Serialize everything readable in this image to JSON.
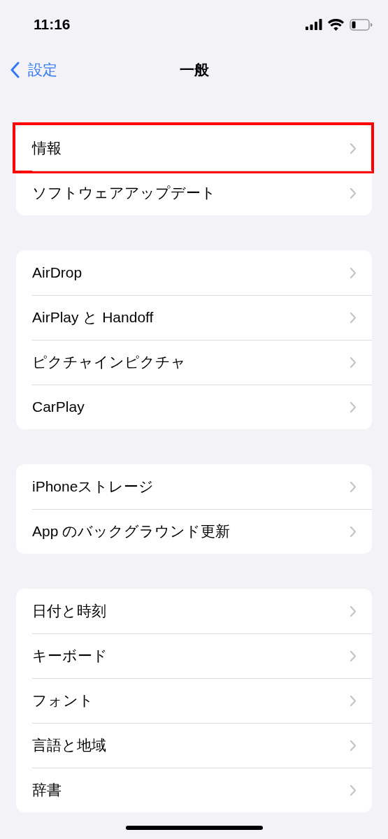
{
  "status_bar": {
    "time": "11:16"
  },
  "nav": {
    "back_label": "設定",
    "title": "一般"
  },
  "groups": [
    {
      "items": [
        {
          "label": "情報",
          "highlighted": true
        },
        {
          "label": "ソフトウェアアップデート",
          "highlighted": false
        }
      ]
    },
    {
      "items": [
        {
          "label": "AirDrop",
          "highlighted": false
        },
        {
          "label": "AirPlay と Handoff",
          "highlighted": false
        },
        {
          "label": "ピクチャインピクチャ",
          "highlighted": false
        },
        {
          "label": "CarPlay",
          "highlighted": false
        }
      ]
    },
    {
      "items": [
        {
          "label": "iPhoneストレージ",
          "highlighted": false
        },
        {
          "label": "App のバックグラウンド更新",
          "highlighted": false
        }
      ]
    },
    {
      "items": [
        {
          "label": "日付と時刻",
          "highlighted": false
        },
        {
          "label": "キーボード",
          "highlighted": false
        },
        {
          "label": "フォント",
          "highlighted": false
        },
        {
          "label": "言語と地域",
          "highlighted": false
        },
        {
          "label": "辞書",
          "highlighted": false
        }
      ]
    }
  ]
}
